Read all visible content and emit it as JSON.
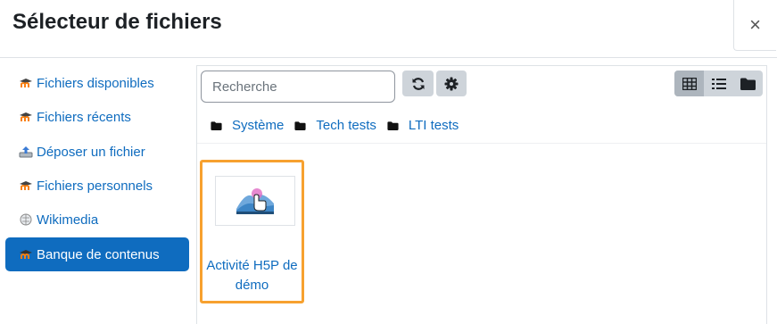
{
  "dialog": {
    "title": "Sélecteur de fichiers",
    "close_label": "×"
  },
  "sidebar": {
    "items": [
      {
        "label": "Fichiers disponibles",
        "icon": "moodle-icon",
        "active": false
      },
      {
        "label": "Fichiers récents",
        "icon": "moodle-icon",
        "active": false
      },
      {
        "label": "Déposer un fichier",
        "icon": "upload-icon",
        "active": false
      },
      {
        "label": "Fichiers personnels",
        "icon": "moodle-icon",
        "active": false
      },
      {
        "label": "Wikimedia",
        "icon": "wikipedia-icon",
        "active": false
      },
      {
        "label": "Banque de contenus",
        "icon": "moodle-icon",
        "active": true
      }
    ]
  },
  "toolbar": {
    "search_placeholder": "Recherche",
    "refresh_icon": "refresh-icon",
    "settings_icon": "gear-icon",
    "views": [
      "grid-view-icon",
      "list-view-icon",
      "folder-view-icon"
    ],
    "active_view": "grid-view-icon"
  },
  "breadcrumb": [
    {
      "label": "Système",
      "icon": "folder-icon"
    },
    {
      "label": "Tech tests",
      "icon": "folder-icon"
    },
    {
      "label": "LTI tests",
      "icon": "folder-icon"
    }
  ],
  "files": [
    {
      "name": "Activité H5P de démo",
      "icon": "h5p-thumbnail",
      "selected": true
    }
  ],
  "colors": {
    "accent": "#0f6cbf",
    "selection": "#f7a12f",
    "button_bg": "#ced4da"
  }
}
